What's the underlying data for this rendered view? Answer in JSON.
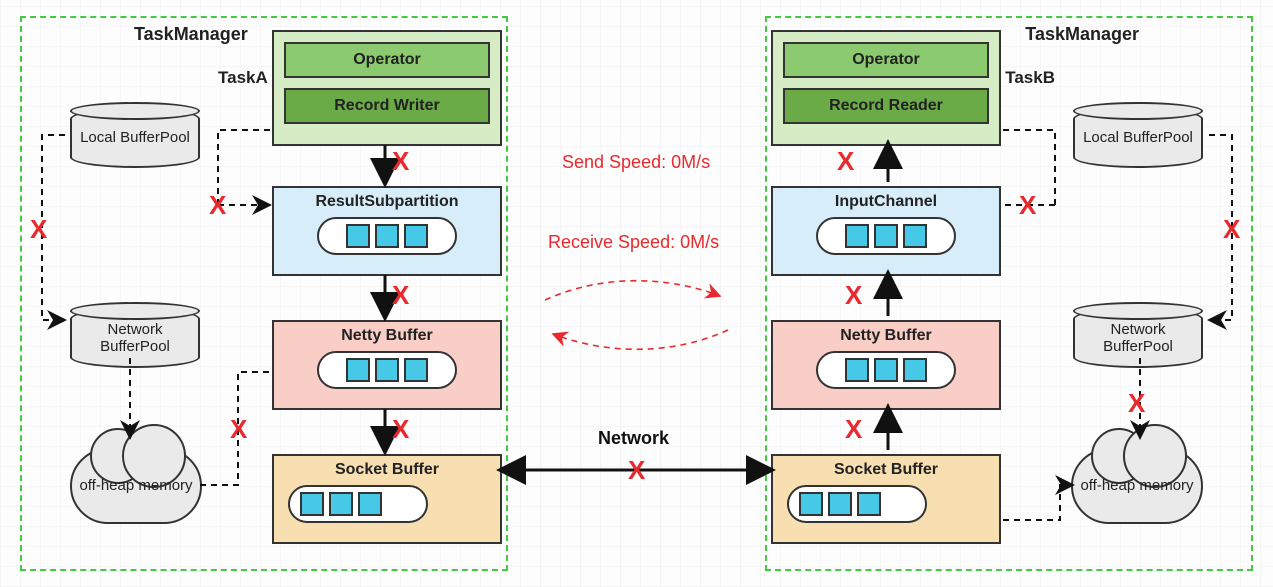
{
  "left": {
    "tm_title": "TaskManager",
    "task_label": "TaskA",
    "operator": "Operator",
    "writer": "Record Writer",
    "sub": "ResultSubpartition",
    "netty": "Netty Buffer",
    "socket": "Socket Buffer",
    "localpool": "Local BufferPool",
    "netpool": "Network BufferPool",
    "offheap": "off-heap memory"
  },
  "right": {
    "tm_title": "TaskManager",
    "task_label": "TaskB",
    "operator": "Operator",
    "reader": "Record Reader",
    "sub": "InputChannel",
    "netty": "Netty Buffer",
    "socket": "Socket Buffer",
    "localpool": "Local BufferPool",
    "netpool": "Network BufferPool",
    "offheap": "off-heap memory"
  },
  "center": {
    "send": "Send Speed: 0M/s",
    "recv": "Receive Speed: 0M/s",
    "network": "Network"
  },
  "x": "X"
}
